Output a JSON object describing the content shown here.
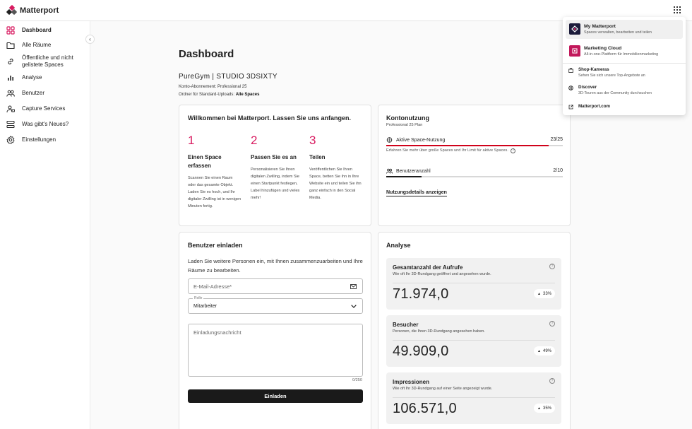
{
  "app": {
    "logo_text": "Matterport"
  },
  "sidebar": {
    "items": [
      {
        "label": "Dashboard",
        "icon": "dashboard-icon"
      },
      {
        "label": "Alle Räume",
        "icon": "folder-icon"
      },
      {
        "label": "Öffentliche und nicht gelistete Spaces",
        "icon": "link-icon"
      },
      {
        "label": "Analyse",
        "icon": "bar-chart-icon"
      },
      {
        "label": "Benutzer",
        "icon": "users-icon"
      },
      {
        "label": "Capture Services",
        "icon": "capture-services-icon"
      },
      {
        "label": "Was gibt's Neues?",
        "icon": "news-icon"
      },
      {
        "label": "Einstellungen",
        "icon": "gear-icon"
      }
    ]
  },
  "header": {
    "title": "Dashboard",
    "account_name": "PureGym | STUDIO 3DSIXTY",
    "subscription_label": "Konto-Abonnement:",
    "subscription_value": "Professional 25",
    "folder_label": "Ordner für Standard-Uploads:",
    "folder_value": "Alle Spaces"
  },
  "welcome": {
    "title": "Willkommen bei Matterport. Lassen Sie uns anfangen.",
    "steps": [
      {
        "number": "1",
        "title": "Einen Space erfassen",
        "desc": "Scannen Sie einen Raum oder das gesamte Objekt. Laden Sie es hoch, und Ihr digitaler Zwilling ist in wenigen Minuten fertig."
      },
      {
        "number": "2",
        "title": "Passen Sie es an",
        "desc": "Personalisieren Sie Ihren digitalen Zwilling, indem Sie einen Startpunkt festlegen, Label hinzufügen und vieles mehr!"
      },
      {
        "number": "3",
        "title": "Teilen",
        "desc": "Veröffentlichen Sie Ihren Space, betten Sie ihn in Ihre Website ein und teilen Sie ihn ganz einfach in den Social Media."
      }
    ]
  },
  "usage": {
    "title": "Kontonutzung",
    "plan": "Professional 25 Plan",
    "active_spaces_label": "Aktive Space-Nutzung",
    "active_spaces_count": "23/25",
    "active_spaces_fraction": 0.92,
    "active_hint": "Erfahren Sie mehr über große Spaces und Ihr Limit für aktive Spaces.",
    "users_label": "Benutzeranzahl",
    "users_count": "2/10",
    "users_fraction": 0.2,
    "details_link": "Nutzungsdetails anzeigen",
    "accent_color": "#d0021b"
  },
  "invite": {
    "title": "Benutzer einladen",
    "text": "Laden Sie weitere Personen ein, mit Ihnen zusammenzuarbeiten und Ihre Räume zu bearbeiten.",
    "email_placeholder": "E-Mail-Adresse*",
    "role_label": "Rolle",
    "role_value": "Mitarbeiter",
    "message_placeholder": "Einladungsnachricht",
    "char_count": "0/250",
    "button_label": "Einladen"
  },
  "analysis": {
    "title": "Analyse",
    "metrics": [
      {
        "title": "Gesamtanzahl der Aufrufe",
        "desc": "Wie oft Ihr 3D-Rundgang geöffnet und angesehen wurde.",
        "value": "71.974,0",
        "change": "33%"
      },
      {
        "title": "Besucher",
        "desc": "Personen, die Ihren 3D-Rundgang angesehen haben.",
        "value": "49.909,0",
        "change": "49%"
      },
      {
        "title": "Impressionen",
        "desc": "Wie oft Ihr 3D-Rundgang auf einer Seite angezeigt wurde.",
        "value": "106.571,0",
        "change": "35%"
      }
    ]
  },
  "apps_menu": {
    "apps": [
      {
        "name": "My Matterport",
        "desc": "Spaces verwalten, bearbeiten und teilen",
        "icon": "my-matterport-icon"
      },
      {
        "name": "Marketing Cloud",
        "desc": "All-in-one-Plattform für Immobilienmarketing",
        "icon": "marketing-cloud-icon"
      }
    ],
    "links": [
      {
        "name": "Shop-Kameras",
        "desc": "Sehen Sie sich unsere Top-Angebote an",
        "icon": "shopping-bag-icon"
      },
      {
        "name": "Discover",
        "desc": "3D-Touren aus der Community durchsuchen",
        "icon": "globe-icon"
      },
      {
        "name": "Matterport.com",
        "icon": "external-link-icon"
      }
    ]
  },
  "colors": {
    "brand": "#d81b60",
    "dark_button": "#1a1a1a"
  }
}
